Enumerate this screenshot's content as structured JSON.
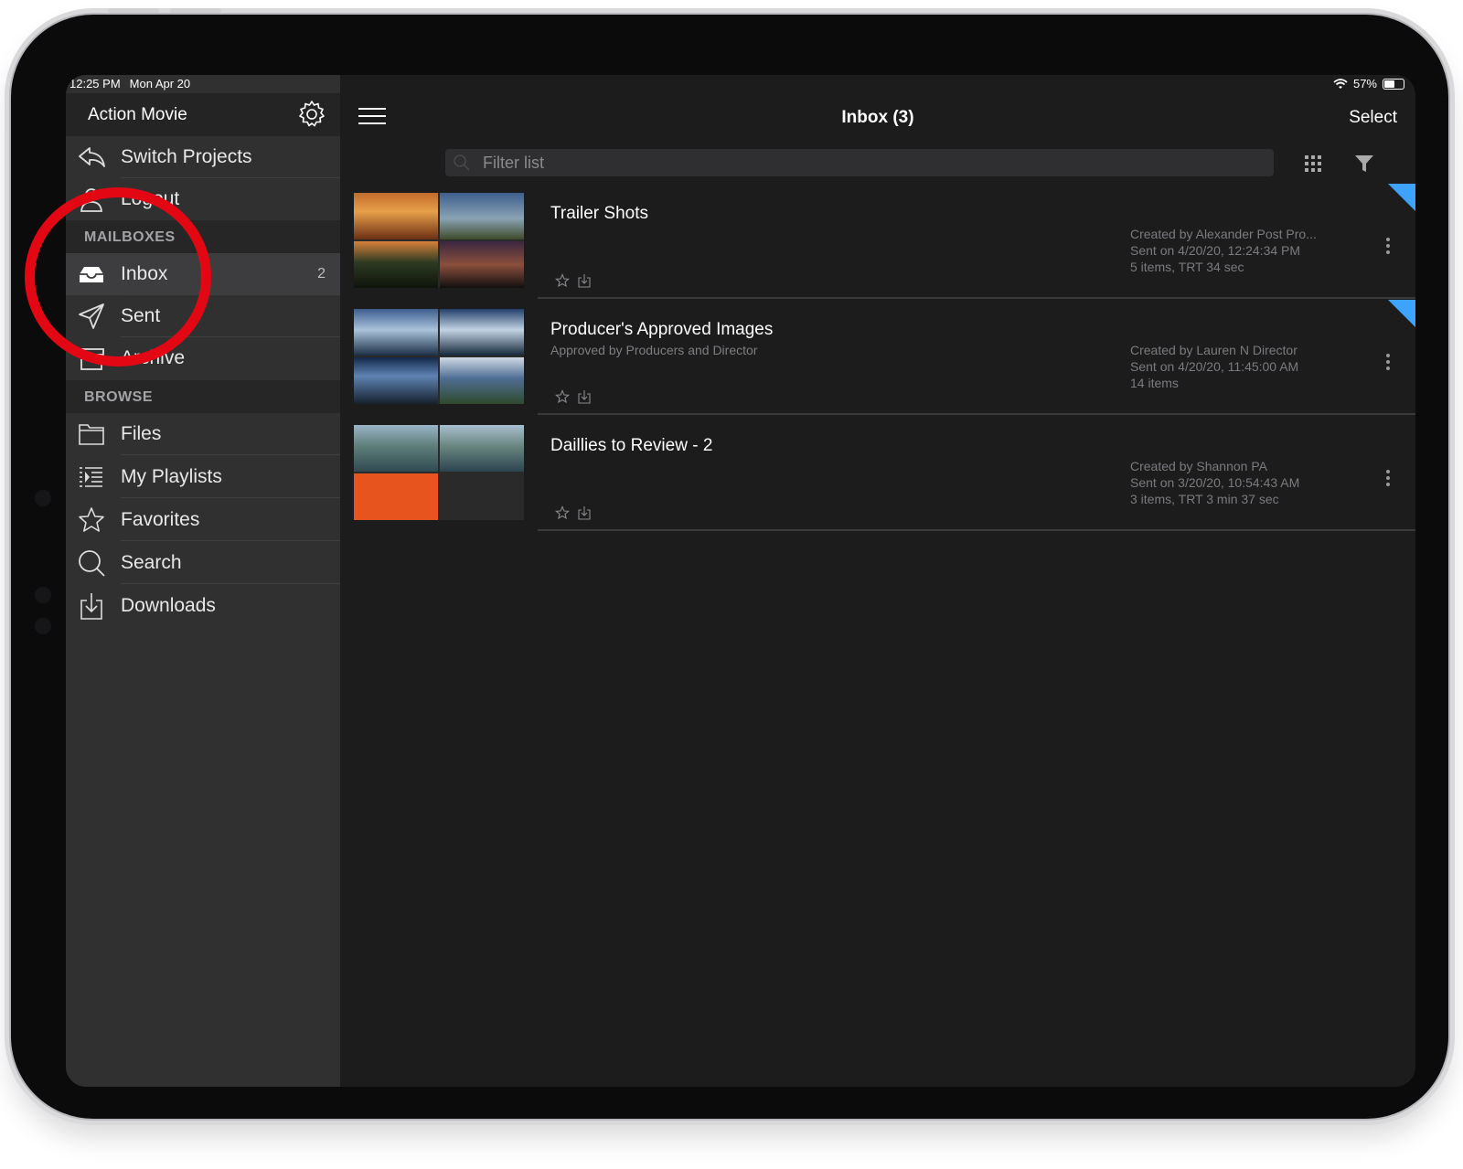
{
  "status": {
    "time": "12:25 PM",
    "date": "Mon Apr 20",
    "battery": "57%",
    "battery_level": 0.57
  },
  "sidebar": {
    "project_title": "Action Movie",
    "switch_projects": "Switch Projects",
    "logout": "Logout",
    "mailboxes_header": "MAILBOXES",
    "mailboxes": [
      {
        "label": "Inbox",
        "count": "2",
        "icon": "inbox-icon"
      },
      {
        "label": "Sent",
        "icon": "send-icon"
      },
      {
        "label": "Archive",
        "icon": "archive-icon"
      }
    ],
    "browse_header": "BROWSE",
    "browse": [
      {
        "label": "Files",
        "icon": "folder-icon"
      },
      {
        "label": "My Playlists",
        "icon": "playlist-icon"
      },
      {
        "label": "Favorites",
        "icon": "star-icon"
      },
      {
        "label": "Search",
        "icon": "search-icon"
      },
      {
        "label": "Downloads",
        "icon": "download-icon"
      }
    ]
  },
  "main": {
    "title": "Inbox (3)",
    "select_label": "Select",
    "filter_placeholder": "Filter list",
    "items": [
      {
        "title": "Trailer Shots",
        "subtitle": "",
        "created": "Created by Alexander Post Pro...",
        "sent": "Sent on 4/20/20, 12:24:34 PM",
        "info": "5 items, TRT 34 sec",
        "unread": true
      },
      {
        "title": "Producer's Approved Images",
        "subtitle": "Approved by Producers and Director",
        "created": "Created by Lauren N Director",
        "sent": "Sent on 4/20/20, 11:45:00 AM",
        "info": "14 items",
        "unread": true
      },
      {
        "title": "Daillies to Review - 2",
        "subtitle": "",
        "created": "Created by Shannon PA",
        "sent": "Sent on 3/20/20, 10:54:43 AM",
        "info": "3 items, TRT 3 min 37 sec",
        "unread": false
      }
    ]
  },
  "colors": {
    "accent_flag": "#3ea3ff",
    "annotation": "#e30613",
    "progress": "#e8541e"
  }
}
